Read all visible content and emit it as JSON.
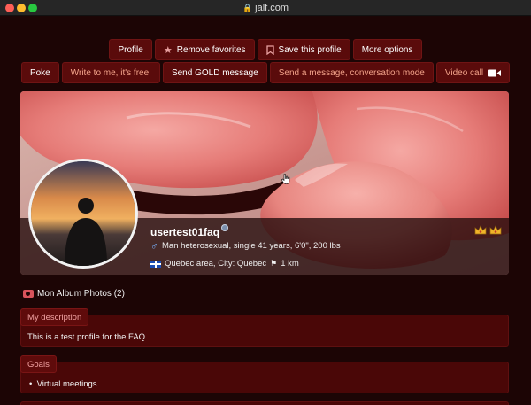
{
  "browser": {
    "url": "jalf.com"
  },
  "actions_row1": {
    "profile": "Profile",
    "remove_favorites": "Remove favorites",
    "save_profile": "Save this profile",
    "more_options": "More options"
  },
  "actions_row2": {
    "poke": "Poke",
    "write_free": "Write to me, it's free!",
    "send_gold": "Send GOLD message",
    "conversation": "Send a message, conversation mode",
    "video_call": "Video call"
  },
  "profile": {
    "username": "usertest01faq",
    "details": "Man heterosexual, single 41 years, 6'0\", 200 lbs",
    "location": "Quebec area, City: Quebec",
    "distance": "1 km"
  },
  "album": {
    "label": "Mon Album Photos (2)"
  },
  "description": {
    "title": "My description",
    "text": "This is a test profile for the FAQ."
  },
  "goals": {
    "title": "Goals",
    "items": [
      "Virtual meetings"
    ]
  },
  "colors": {
    "page_bg": "#1c0505",
    "button_bg": "#5a0b0b",
    "section_bg": "#4a0707",
    "accent_text": "#f3a38a"
  }
}
